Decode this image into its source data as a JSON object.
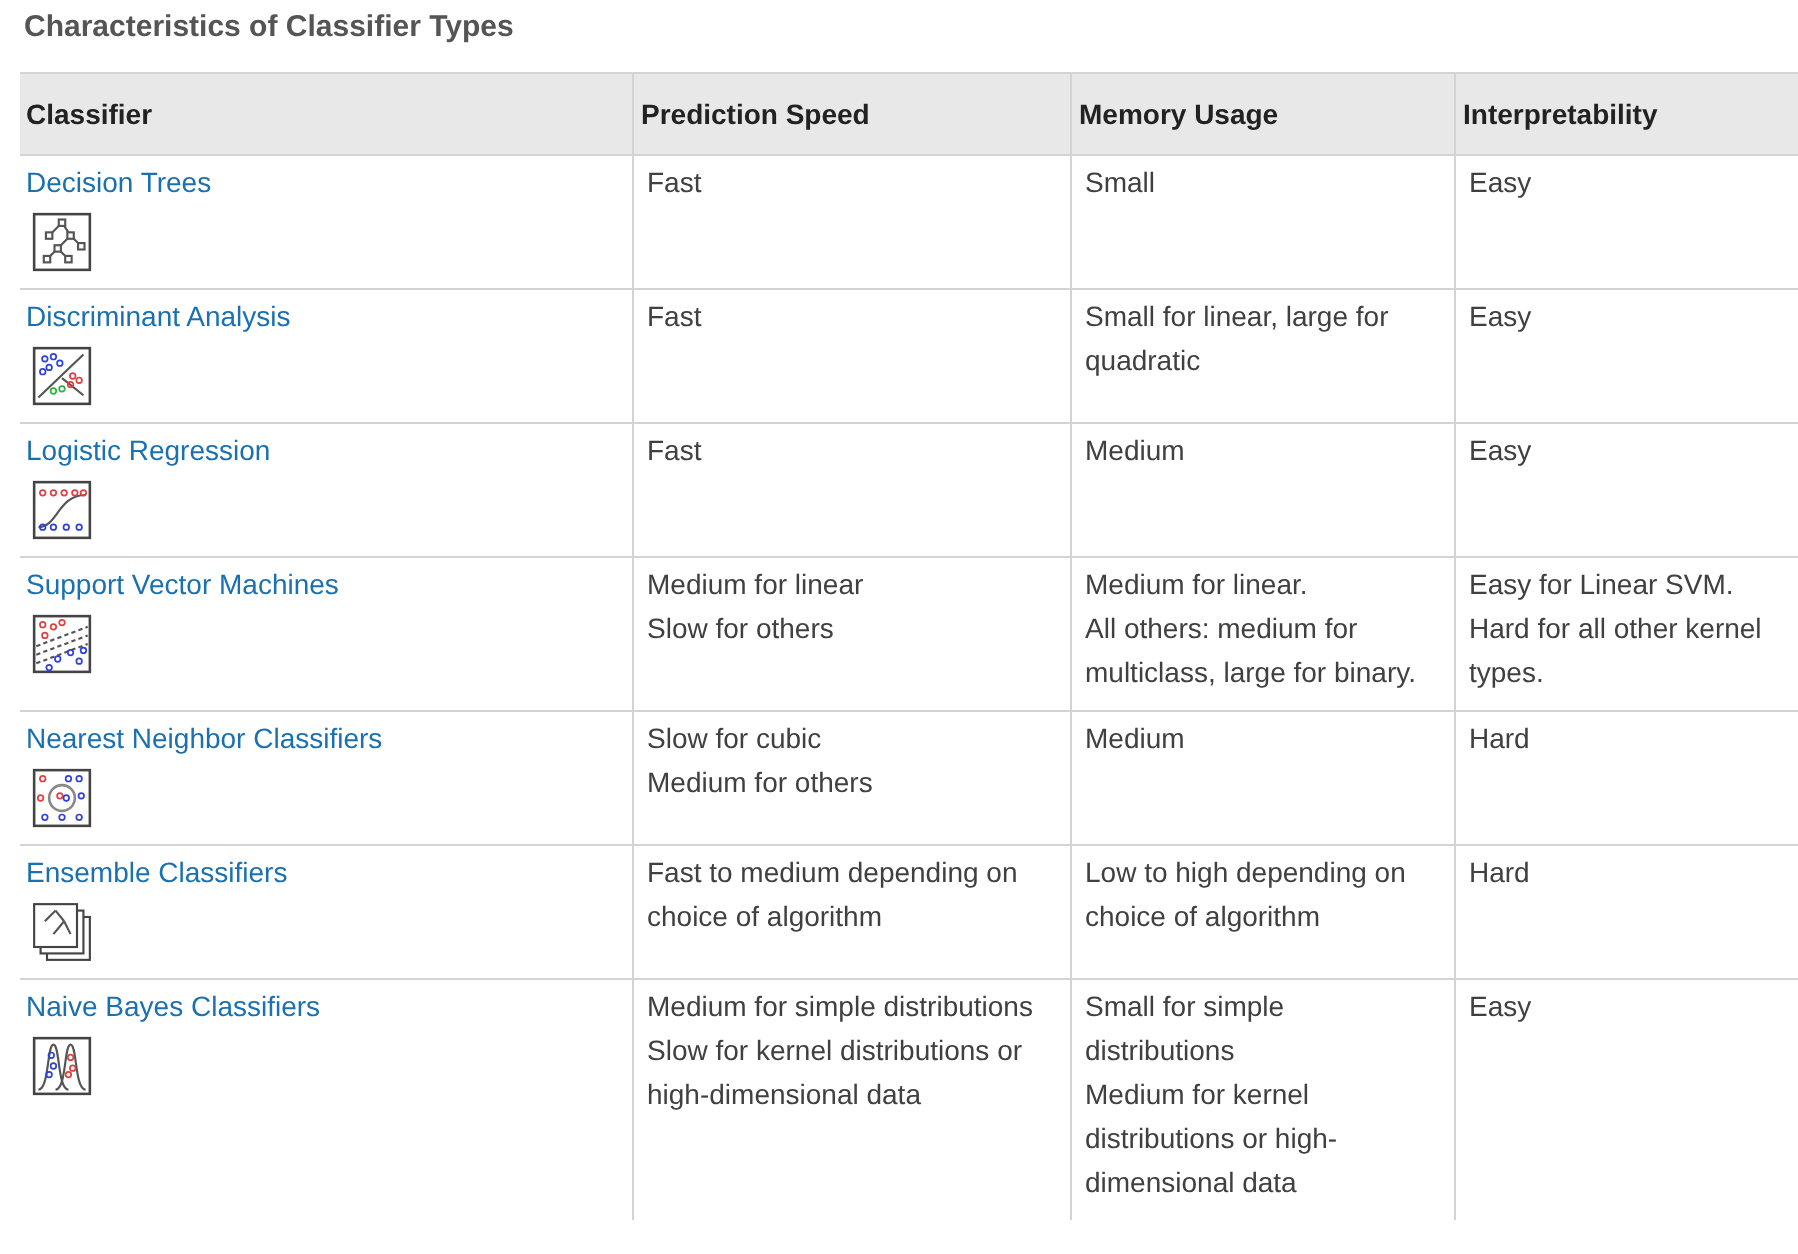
{
  "heading": "Characteristics of Classifier Types",
  "table": {
    "columns": [
      "Classifier",
      "Prediction Speed",
      "Memory Usage",
      "Interpretability"
    ],
    "rows": [
      {
        "classifier": "Decision Trees",
        "prediction_speed": [
          "Fast"
        ],
        "memory_usage": [
          "Small"
        ],
        "interpretability": [
          "Easy"
        ]
      },
      {
        "classifier": "Discriminant Analysis",
        "prediction_speed": [
          "Fast"
        ],
        "memory_usage": [
          "Small for linear, large for quadratic"
        ],
        "interpretability": [
          "Easy"
        ]
      },
      {
        "classifier": "Logistic Regression",
        "prediction_speed": [
          "Fast"
        ],
        "memory_usage": [
          "Medium"
        ],
        "interpretability": [
          "Easy"
        ]
      },
      {
        "classifier": "Support Vector Machines",
        "prediction_speed": [
          "Medium for linear",
          "Slow for others"
        ],
        "memory_usage": [
          "Medium for linear.",
          "All others: medium for multiclass, large for binary."
        ],
        "interpretability": [
          "Easy for Linear SVM.",
          "Hard for all other kernel types."
        ]
      },
      {
        "classifier": "Nearest Neighbor Classifiers",
        "prediction_speed": [
          "Slow for cubic",
          "Medium for others"
        ],
        "memory_usage": [
          "Medium"
        ],
        "interpretability": [
          "Hard"
        ]
      },
      {
        "classifier": "Ensemble Classifiers",
        "prediction_speed": [
          "Fast to medium depending on choice of algorithm"
        ],
        "memory_usage": [
          "Low to high depending on choice of algorithm"
        ],
        "interpretability": [
          "Hard"
        ]
      },
      {
        "classifier": "Naive Bayes Classifiers",
        "prediction_speed": [
          "Medium for simple distributions",
          "Slow for kernel distributions or high-dimensional data"
        ],
        "memory_usage": [
          "Small for simple distributions",
          "Medium for kernel distributions or high-dimensional data"
        ],
        "interpretability": [
          "Easy"
        ]
      }
    ]
  }
}
